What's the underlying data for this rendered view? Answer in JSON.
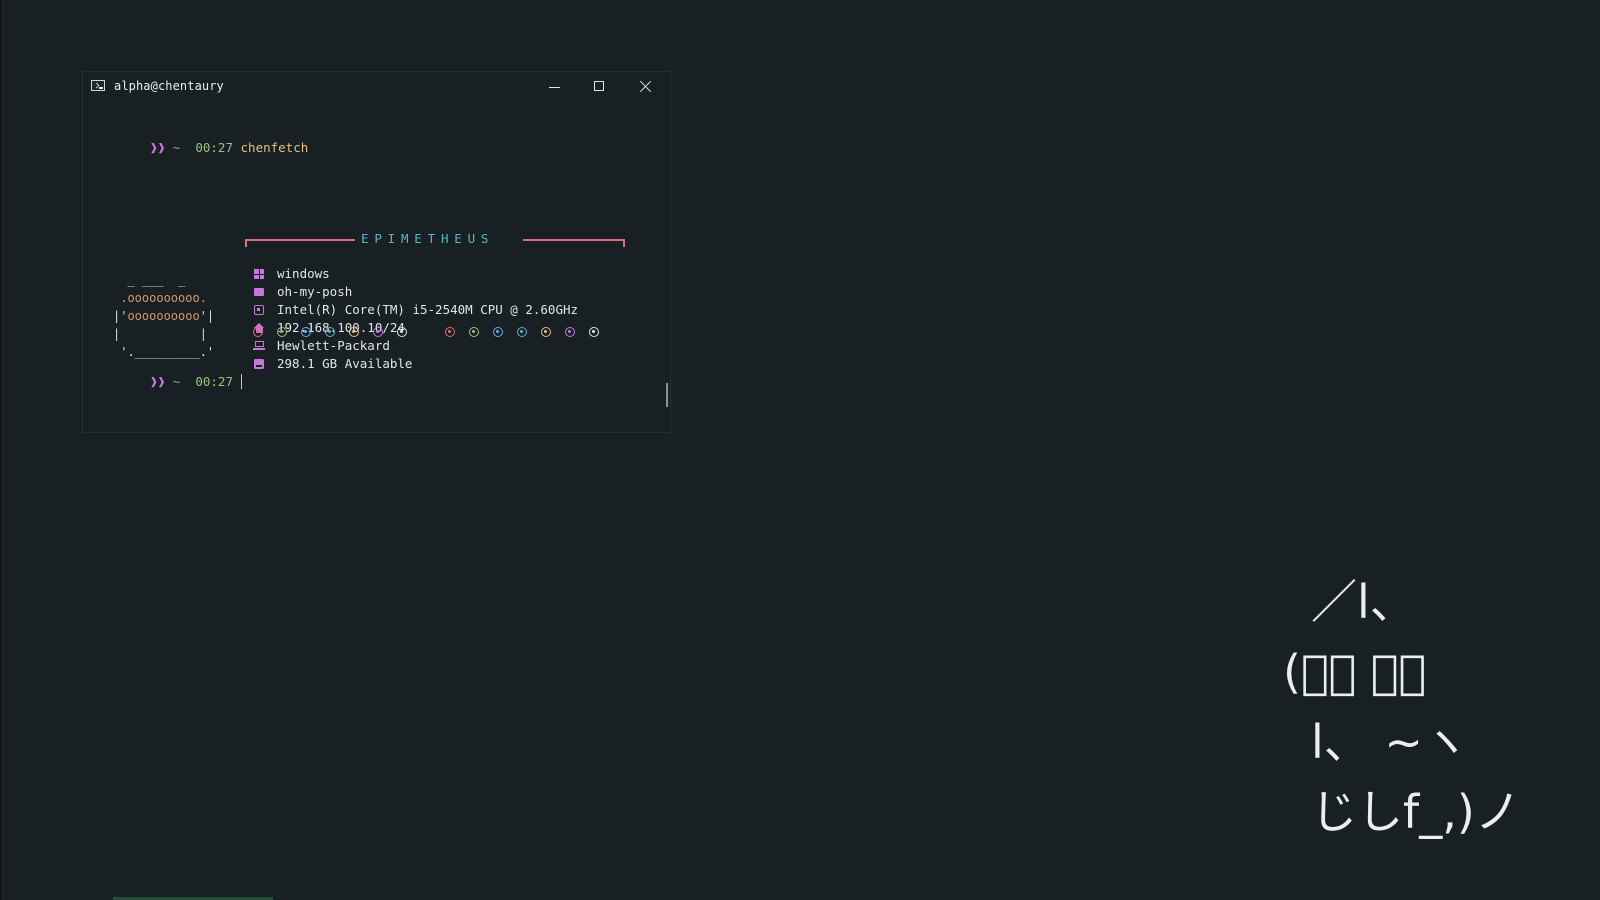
{
  "window": {
    "title": "alpha@chentaury",
    "icon": "terminal-icon",
    "controls": [
      "minimize-icon",
      "maximize-icon",
      "close-icon"
    ]
  },
  "prompt1": {
    "arrow": "❱",
    "arrow2": "❱",
    "tilde": "~",
    "time": "00:27",
    "command": "chenfetch"
  },
  "fetch": {
    "header": "EPIMETHEUS",
    "ascii": {
      "l1": "  _ ___  _",
      "l2a": " .",
      "l2o": "oooooooooo",
      "l2b": ".",
      "l3a": "|'",
      "l3o": "oooooooooo",
      "l3b": "'|",
      "l4": "|           |",
      "l5": " '._________.'"
    },
    "info": [
      {
        "icon": "windows-icon",
        "text": "windows"
      },
      {
        "icon": "shell-icon",
        "text": "oh-my-posh"
      },
      {
        "icon": "cpu-icon",
        "text": "Intel(R) Core(TM) i5-2540M CPU @ 2.60GHz"
      },
      {
        "icon": "home-icon",
        "text": "192.168.100.10/24"
      },
      {
        "icon": "laptop-icon",
        "text": "Hewlett-Packard"
      },
      {
        "icon": "disk-icon",
        "text": "298.1 GB Available"
      }
    ],
    "palette_colors": [
      "#e06c75",
      "#98c379",
      "#61afef",
      "#56b6c2",
      "#e5c07b",
      "#c678dd",
      "#dfe5e8"
    ]
  },
  "prompt2": {
    "arrow": "❱",
    "arrow2": "❱",
    "tilde": "~",
    "time": "00:27"
  },
  "kaomoji": {
    "l1": "／l、",
    "l2": "(ﾟ､ ｡７",
    "l3": "l、 ~ヽ",
    "l4": "じしf_,)ノ"
  },
  "colors": {
    "desktop_bg": "#192024",
    "accent_purple": "#c678dd",
    "accent_green": "#98c379",
    "accent_yellow": "#e5c07b",
    "accent_red": "#e06c75",
    "accent_cyan": "#56b6c2",
    "ascii_orange": "#d19a66"
  }
}
